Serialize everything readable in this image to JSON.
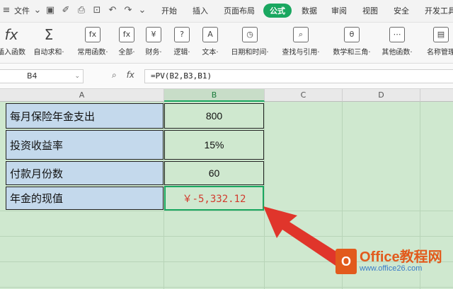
{
  "menubar": {
    "file": "文件",
    "tabs": [
      "开始",
      "插入",
      "页面布局",
      "公式",
      "数据",
      "审阅",
      "视图",
      "安全",
      "开发工具"
    ],
    "active_tab": "公式"
  },
  "ribbon": {
    "items": [
      {
        "label": "插入函数",
        "icon": "fx"
      },
      {
        "label": "自动求和·",
        "icon": "Σ"
      },
      {
        "label": "常用函数·",
        "icon": "fx"
      },
      {
        "label": "全部·",
        "icon": "fx"
      },
      {
        "label": "财务·",
        "icon": "¥"
      },
      {
        "label": "逻辑·",
        "icon": "?"
      },
      {
        "label": "文本·",
        "icon": "A"
      },
      {
        "label": "日期和时间·",
        "icon": "◷"
      },
      {
        "label": "查找与引用·",
        "icon": "⌕"
      },
      {
        "label": "数学和三角·",
        "icon": "θ"
      },
      {
        "label": "其他函数·",
        "icon": "⋯"
      },
      {
        "label": "名称管理",
        "icon": "▤"
      }
    ]
  },
  "formula_bar": {
    "name_box": "B4",
    "fx_label": "fx",
    "formula": "=PV(B2,B3,B1)"
  },
  "columns": [
    "A",
    "B",
    "C",
    "D"
  ],
  "rows": [
    {
      "label": "每月保险年金支出",
      "value": "800"
    },
    {
      "label": "投资收益率",
      "value": "15%"
    },
    {
      "label": "付款月份数",
      "value": "60"
    },
    {
      "label": "年金的现值",
      "value": "￥-5,332.12"
    }
  ],
  "watermark": {
    "logo": "O",
    "brand": "Office教程网",
    "url": "www.office26.com"
  },
  "colors": {
    "accent": "#1aa760",
    "result": "#d23b2e",
    "arrow": "#e0352b"
  }
}
